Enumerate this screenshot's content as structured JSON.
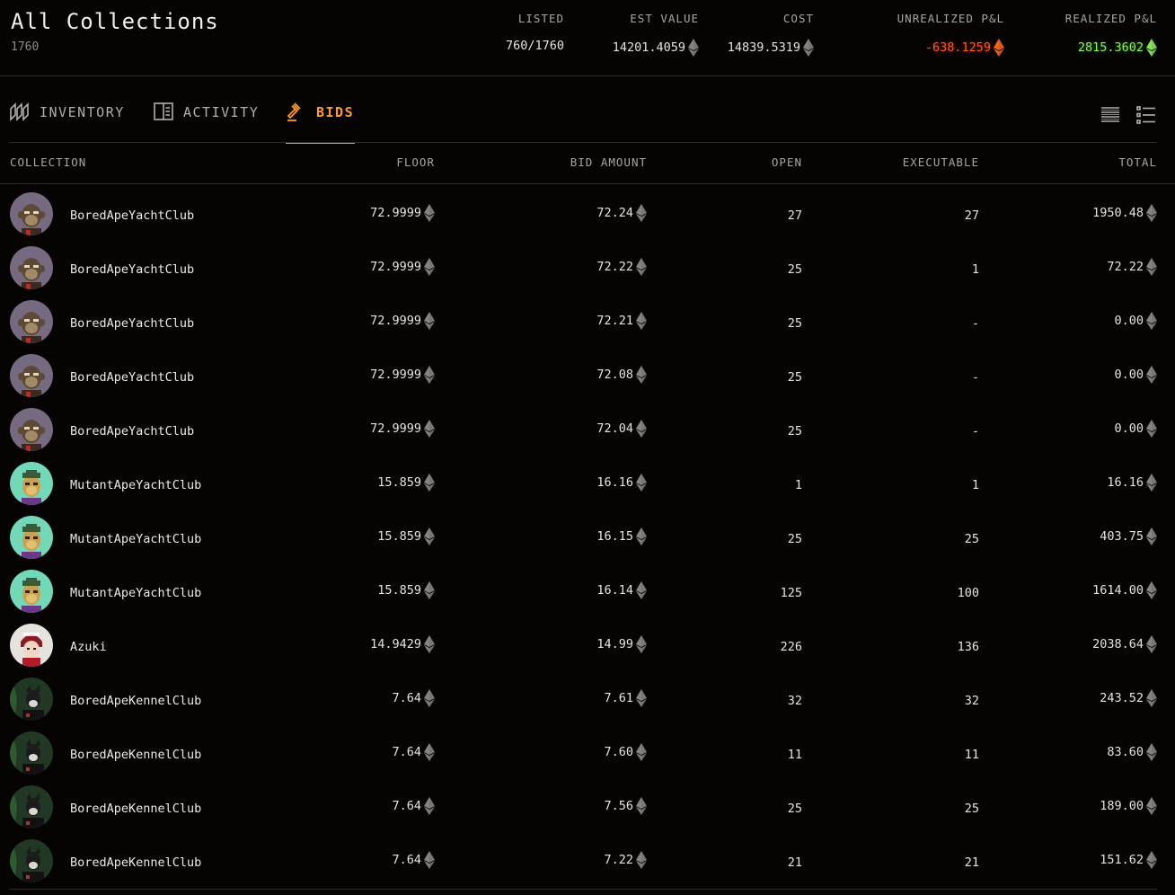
{
  "header": {
    "title": "All Collections",
    "count": "1760",
    "stats": [
      {
        "label": "LISTED",
        "value": "760/1760",
        "eth": false,
        "tone": "normal"
      },
      {
        "label": "EST VALUE",
        "value": "14201.4059",
        "eth": true,
        "tone": "normal"
      },
      {
        "label": "COST",
        "value": "14839.5319",
        "eth": true,
        "tone": "normal"
      },
      {
        "label": "UNREALIZED P&L",
        "value": "-638.1259",
        "eth": true,
        "tone": "negative"
      },
      {
        "label": "REALIZED P&L",
        "value": "2815.3602",
        "eth": true,
        "tone": "positive"
      }
    ]
  },
  "tabs": [
    {
      "label": "INVENTORY",
      "icon": "inventory-icon",
      "active": false
    },
    {
      "label": "ACTIVITY",
      "icon": "activity-icon",
      "active": false
    },
    {
      "label": "BIDS",
      "icon": "gavel-icon",
      "active": true
    }
  ],
  "view_toggles": [
    "list-view-icon",
    "detailed-list-view-icon"
  ],
  "table": {
    "columns": [
      "COLLECTION",
      "FLOOR",
      "BID AMOUNT",
      "OPEN",
      "EXECUTABLE",
      "TOTAL"
    ],
    "rows": [
      {
        "collection": "BoredApeYachtClub",
        "avatar": "bayc",
        "floor": "72.9999",
        "bid": "72.24",
        "open": "27",
        "executable": "27",
        "total": "1950.48"
      },
      {
        "collection": "BoredApeYachtClub",
        "avatar": "bayc",
        "floor": "72.9999",
        "bid": "72.22",
        "open": "25",
        "executable": "1",
        "total": "72.22"
      },
      {
        "collection": "BoredApeYachtClub",
        "avatar": "bayc",
        "floor": "72.9999",
        "bid": "72.21",
        "open": "25",
        "executable": "-",
        "total": "0.00"
      },
      {
        "collection": "BoredApeYachtClub",
        "avatar": "bayc",
        "floor": "72.9999",
        "bid": "72.08",
        "open": "25",
        "executable": "-",
        "total": "0.00"
      },
      {
        "collection": "BoredApeYachtClub",
        "avatar": "bayc",
        "floor": "72.9999",
        "bid": "72.04",
        "open": "25",
        "executable": "-",
        "total": "0.00"
      },
      {
        "collection": "MutantApeYachtClub",
        "avatar": "mayc",
        "floor": "15.859",
        "bid": "16.16",
        "open": "1",
        "executable": "1",
        "total": "16.16"
      },
      {
        "collection": "MutantApeYachtClub",
        "avatar": "mayc",
        "floor": "15.859",
        "bid": "16.15",
        "open": "25",
        "executable": "25",
        "total": "403.75"
      },
      {
        "collection": "MutantApeYachtClub",
        "avatar": "mayc",
        "floor": "15.859",
        "bid": "16.14",
        "open": "125",
        "executable": "100",
        "total": "1614.00"
      },
      {
        "collection": "Azuki",
        "avatar": "azuki",
        "floor": "14.9429",
        "bid": "14.99",
        "open": "226",
        "executable": "136",
        "total": "2038.64"
      },
      {
        "collection": "BoredApeKennelClub",
        "avatar": "bakc",
        "floor": "7.64",
        "bid": "7.61",
        "open": "32",
        "executable": "32",
        "total": "243.52"
      },
      {
        "collection": "BoredApeKennelClub",
        "avatar": "bakc",
        "floor": "7.64",
        "bid": "7.60",
        "open": "11",
        "executable": "11",
        "total": "83.60"
      },
      {
        "collection": "BoredApeKennelClub",
        "avatar": "bakc",
        "floor": "7.64",
        "bid": "7.56",
        "open": "25",
        "executable": "25",
        "total": "189.00"
      },
      {
        "collection": "BoredApeKennelClub",
        "avatar": "bakc",
        "floor": "7.64",
        "bid": "7.22",
        "open": "21",
        "executable": "21",
        "total": "151.62"
      }
    ]
  },
  "colors": {
    "background": "#060303",
    "accent": "#ff9a2c",
    "negative": "#ff5b1f",
    "positive": "#8df25b"
  }
}
